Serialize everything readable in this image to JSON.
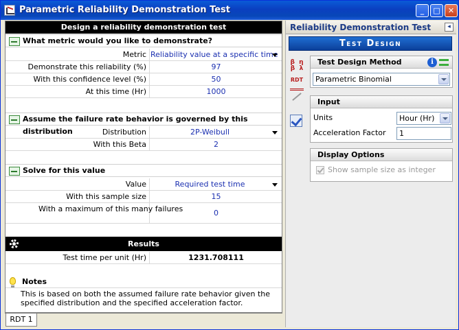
{
  "window": {
    "title": "Parametric Reliability Demonstration Test",
    "min_glyph": "_",
    "max_glyph": "□",
    "close_glyph": "✕"
  },
  "main": {
    "header": "Design a reliability demonstration test",
    "section1": {
      "heading": "What metric would you like to demonstrate?",
      "rows": [
        {
          "label": "Metric",
          "value": "Reliability value at a specific time",
          "dropdown": true
        },
        {
          "label": "Demonstrate this reliability (%)",
          "value": "97"
        },
        {
          "label": "With this confidence level (%)",
          "value": "50"
        },
        {
          "label": "At this time (Hr)",
          "value": "1000"
        }
      ]
    },
    "section2": {
      "heading": "Assume the failure rate behavior is governed by this distribution",
      "rows": [
        {
          "label": "Distribution",
          "value": "2P-Weibull",
          "dropdown": true
        },
        {
          "label": "With this Beta",
          "value": "2"
        }
      ]
    },
    "section3": {
      "heading": "Solve for this value",
      "rows": [
        {
          "label": "Value",
          "value": "Required test time",
          "dropdown": true
        },
        {
          "label": "With this sample size",
          "value": "15"
        },
        {
          "label": "With a maximum of this many failures",
          "value": "0"
        }
      ]
    },
    "results": {
      "heading": "Results",
      "label": "Test time per unit (Hr)",
      "value": "1231.708111"
    },
    "notes": {
      "heading": "Notes",
      "text": "This is based on both the assumed failure rate behavior given the specified distribution and the specified acceleration factor."
    }
  },
  "tabs": [
    "RDT 1"
  ],
  "panel": {
    "title": "Reliability Demonstration Test",
    "collapse_glyph": "◂",
    "banner": "Test Design",
    "side_icons": {
      "beta": "β  η\nβ  λ",
      "rdt": "RDT"
    },
    "method_group": {
      "heading": "Test Design Method",
      "info_glyph": "i",
      "selected": "Parametric Binomial"
    },
    "input_group": {
      "heading": "Input",
      "units_label": "Units",
      "units_value": "Hour (Hr)",
      "af_label": "Acceleration Factor",
      "af_value": "1"
    },
    "display_group": {
      "heading": "Display Options",
      "checkbox_label": "Show sample size as integer",
      "checked": true,
      "disabled": true
    }
  }
}
